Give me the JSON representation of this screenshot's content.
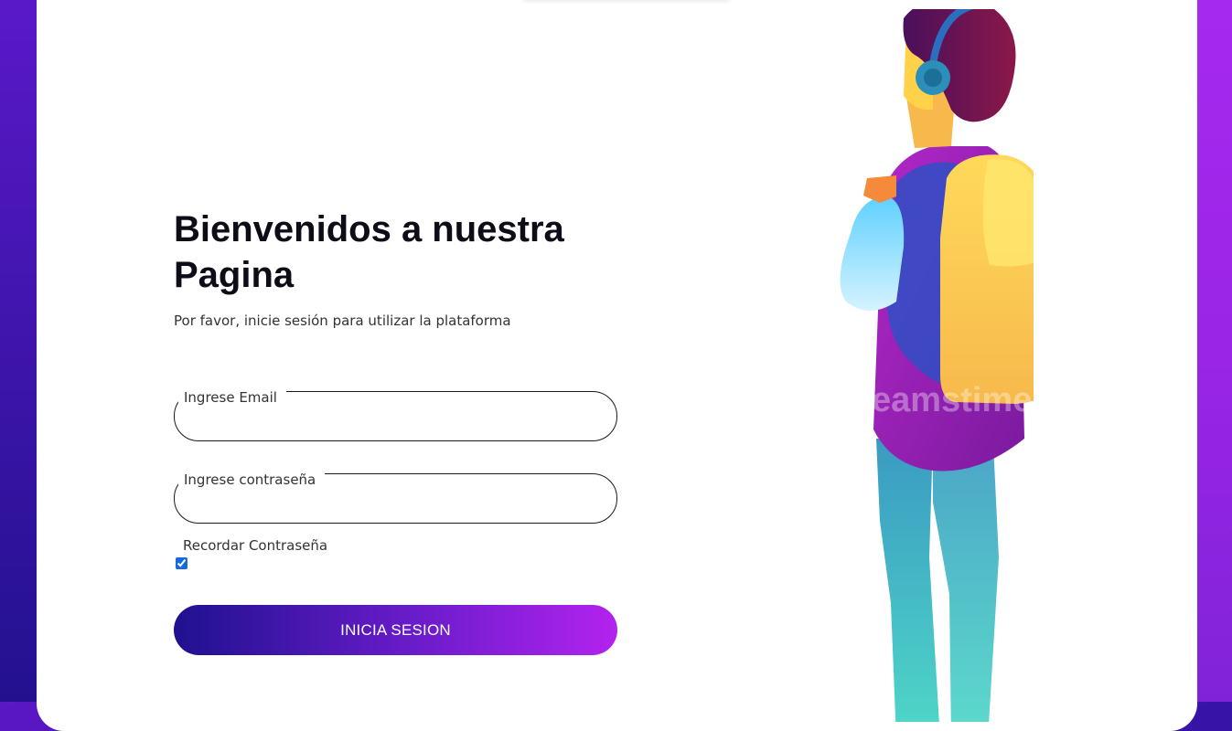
{
  "login": {
    "title": "Bienvenidos a nuestra Pagina",
    "subtitle": "Por favor, inicie sesión para utilizar la plataforma",
    "email_label": "Ingrese Email",
    "email_value": "",
    "password_label": "Ingrese contraseña",
    "password_value": "",
    "remember_label": "Recordar Contraseña",
    "remember_checked": true,
    "submit_label": "INICIA SESION"
  },
  "illustration": {
    "subject": "student with headphones and backpack",
    "icon": "student-illustration",
    "watermark": "dreamstime."
  },
  "colors": {
    "bg_gradient_start": "#5a17c4",
    "bg_gradient_end": "#8a24e0",
    "button_start": "#1f118f",
    "button_end": "#b323ee",
    "checkbox_accent": "#1769e0"
  }
}
